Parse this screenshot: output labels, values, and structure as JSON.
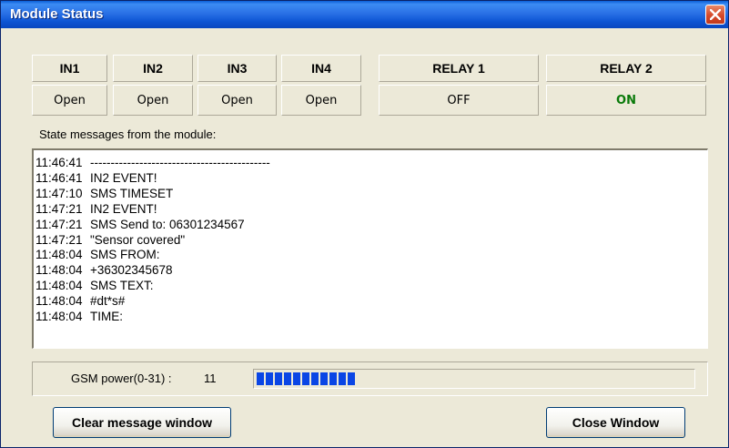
{
  "window": {
    "title": "Module Status",
    "close_icon": "close-icon"
  },
  "inputs": [
    {
      "name": "IN1",
      "state": "Open"
    },
    {
      "name": "IN2",
      "state": "Open"
    },
    {
      "name": "IN3",
      "state": "Open"
    },
    {
      "name": "IN4",
      "state": "Open"
    }
  ],
  "relays": [
    {
      "name": "RELAY 1",
      "state": "OFF",
      "color": "#000000"
    },
    {
      "name": "RELAY 2",
      "state": "ON",
      "color": "#0a7a0a"
    }
  ],
  "messages": {
    "label": "State messages from the module:",
    "lines": [
      {
        "time": "11:46:41",
        "text": "--------------------------------------------"
      },
      {
        "time": "11:46:41",
        "text": "IN2 EVENT!"
      },
      {
        "time": "11:47:10",
        "text": "SMS TIMESET"
      },
      {
        "time": "11:47:21",
        "text": "IN2 EVENT!"
      },
      {
        "time": "11:47:21",
        "text": "SMS Send to: 06301234567"
      },
      {
        "time": "11:47:21",
        "text": "\"Sensor covered\""
      },
      {
        "time": "11:48:04",
        "text": "SMS FROM:"
      },
      {
        "time": "11:48:04",
        "text": "+36302345678"
      },
      {
        "time": "11:48:04",
        "text": "SMS TEXT:"
      },
      {
        "time": "11:48:04",
        "text": "#dt*s#"
      },
      {
        "time": "11:48:04",
        "text": "TIME:"
      }
    ]
  },
  "gsm": {
    "label": "GSM power(0-31) :",
    "value": "11",
    "max": 31,
    "bar_color": "#0b46e5"
  },
  "buttons": {
    "clear": "Clear message window",
    "close": "Close Window"
  }
}
